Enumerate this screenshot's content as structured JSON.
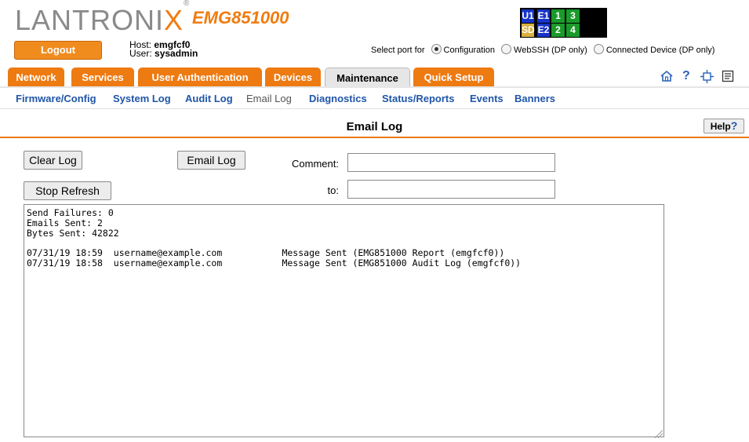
{
  "header": {
    "brand_left": "LANTRONI",
    "brand_x": "X",
    "brand_reg": "®",
    "model": "EMG851000",
    "logout_label": "Logout",
    "host_label": "Host:",
    "host_value": "emgfcf0",
    "user_label": "User:",
    "user_value": "sysadmin",
    "ports": [
      "U1",
      "E1",
      "1",
      "3",
      "SD",
      "E2",
      "2",
      "4"
    ],
    "select_port_label": "Select port for",
    "port_options": [
      "Configuration",
      "WebSSH (DP only)",
      "Connected Device (DP only)"
    ],
    "selected_port_option": "Configuration"
  },
  "tabs": [
    "Network",
    "Services",
    "User Authentication",
    "Devices",
    "Maintenance",
    "Quick Setup"
  ],
  "active_tab": "Maintenance",
  "toolbar_icons": [
    "home-icon",
    "help-icon",
    "expand-icon",
    "notes-icon"
  ],
  "toolbar_help_glyph": "?",
  "subnav": [
    "Firmware/Config",
    "System Log",
    "Audit Log",
    "Email Log",
    "Diagnostics",
    "Status/Reports",
    "Events",
    "Banners"
  ],
  "active_subnav": "Email Log",
  "page": {
    "title": "Email Log",
    "help_label": "Help",
    "help_mark": "?"
  },
  "form": {
    "clear_log_label": "Clear Log",
    "email_log_label": "Email Log",
    "stop_refresh_label": "Stop Refresh",
    "comment_label": "Comment:",
    "comment_value": "",
    "to_label": "to:",
    "to_value": ""
  },
  "log": {
    "stats": [
      "Send Failures: 0",
      "Emails Sent: 2",
      "Bytes Sent: 42822"
    ],
    "entries": [
      {
        "timestamp": "07/31/19 18:59",
        "recipient": "username@example.com",
        "message": "Message Sent (EMG851000 Report (emgfcf0))"
      },
      {
        "timestamp": "07/31/19 18:58",
        "recipient": "username@example.com",
        "message": "Message Sent (EMG851000 Audit Log (emgfcf0))"
      }
    ]
  },
  "colors": {
    "accent": "#ee7a12",
    "link": "#1f55a8",
    "port_green": "#1a9a2a",
    "port_blue": "#1733c8",
    "port_gold": "#d8b040"
  }
}
